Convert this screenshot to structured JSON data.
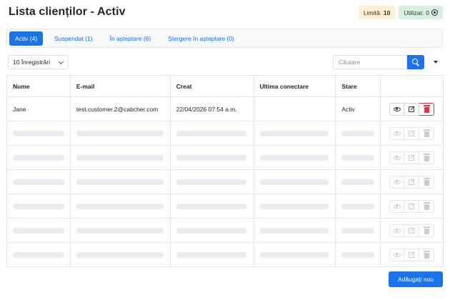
{
  "page": {
    "title": "Lista clienților - Activ"
  },
  "badges": {
    "limit_label": "Limită:",
    "limit_value": "10",
    "used_label": "Utilizat:",
    "used_value": "0",
    "used_icon": "eye-icon"
  },
  "tabs": [
    {
      "label": "Activ (4)",
      "active": true
    },
    {
      "label": "Suspendat (1)",
      "active": false
    },
    {
      "label": "În așteptare (6)",
      "active": false
    },
    {
      "label": "Ștergere în așteptare (0)",
      "active": false
    }
  ],
  "toolbar": {
    "per_page": "10 Înregistrări",
    "search_placeholder": "Căutare"
  },
  "table": {
    "columns": [
      "Nume",
      "E-mail",
      "Creat",
      "Ultima conectare",
      "Stare",
      ""
    ],
    "rows": [
      {
        "name": "Jane",
        "email": "test.customer.2@cabcher.com",
        "created": "22/04/2026 07:54 a.m.",
        "last_login": "",
        "status": "Activ"
      }
    ],
    "placeholder_rows": 6
  },
  "colors": {
    "accent": "#1a73e8",
    "danger": "#dc3545"
  },
  "add_button": "Adăugați nou"
}
